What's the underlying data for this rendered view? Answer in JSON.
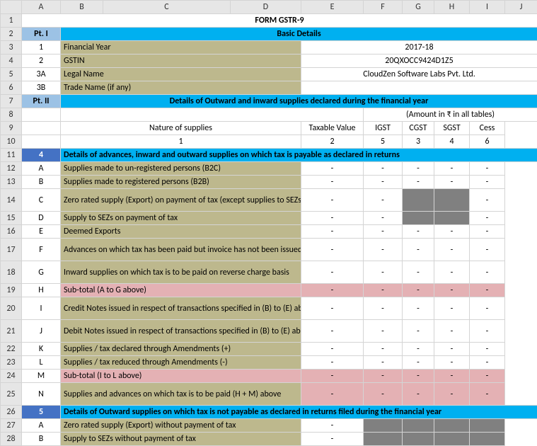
{
  "cols": [
    "A",
    "B",
    "C",
    "D",
    "E",
    "F",
    "G",
    "H",
    "I",
    "J"
  ],
  "title": "FORM GSTR-9",
  "part1": "Pt. I",
  "part1_title": "Basic Details",
  "basic": {
    "r3": {
      "num": "1",
      "label": "Financial Year",
      "value": "2017-18"
    },
    "r4": {
      "num": "2",
      "label": "GSTIN",
      "value": "20QXOCC9424D1Z5"
    },
    "r5": {
      "num": "3A",
      "label": "Legal Name",
      "value": "CloudZen Software Labs Pvt. Ltd."
    },
    "r6": {
      "num": "3B",
      "label": "Trade Name (if any)",
      "value": ""
    }
  },
  "part2": "Pt. II",
  "part2_title": "Details of Outward and inward supplies declared during the financial year",
  "amount_note": "(Amount in ₹ in all tables)",
  "hdr": {
    "nature": "Nature of supplies",
    "taxable": "Taxable Value",
    "igst": "IGST",
    "cgst": "CGST",
    "sgst": "SGST",
    "cess": "Cess"
  },
  "nums": {
    "c1": "1",
    "c2": "2",
    "c5": "5",
    "c3": "3",
    "c4": "4",
    "c6": "6"
  },
  "sec4": {
    "num": "4",
    "title": "Details of advances, inward and outward supplies on which tax is payable as declared in returns"
  },
  "rows4": {
    "A": "Supplies made to un-registered persons (B2C)",
    "B": "Supplies made to registered persons (B2B)",
    "C": "Zero rated supply (Export) on payment of tax (except supplies to SEZs)",
    "D": "Supply to SEZs on payment of tax",
    "E": "Deemed Exports",
    "F": "Advances on which tax has been paid but invoice has not been issued (not covered under (A) to (E) above)",
    "G": "Inward supplies on which tax is to be paid on reverse charge basis",
    "H": "Sub-total (A to G above)",
    "I": "Credit Notes issued in respect of transactions specified in (B) to (E) above (-)",
    "J": "Debit Notes issued in respect of transactions specified in (B) to (E) above (+)",
    "K": "Supplies / tax declared through Amendments (+)",
    "L": "Supplies / tax reduced through Amendments (-)",
    "M": "Sub-total (I to L above)",
    "N": "Supplies and advances on which tax is to be paid (H + M) above"
  },
  "sec5": {
    "num": "5",
    "title": "Details of Outward supplies on which tax is not payable as declared in returns filed during the financial year"
  },
  "rows5": {
    "A": "Zero rated supply (Export) without payment of tax",
    "B": "Supply to SEZs without payment of tax"
  },
  "dash": "-"
}
